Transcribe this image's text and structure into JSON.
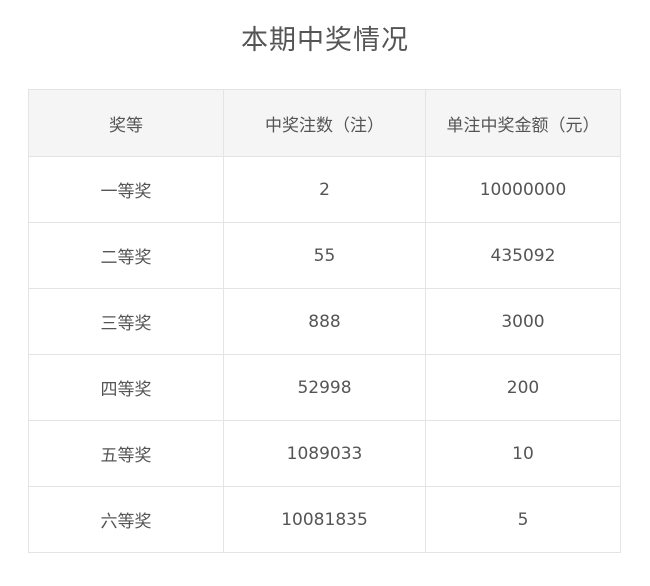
{
  "title": "本期中奖情况",
  "table": {
    "headers": [
      "奖等",
      "中奖注数（注）",
      "单注中奖金额（元）"
    ],
    "rows": [
      [
        "一等奖",
        "2",
        "10000000"
      ],
      [
        "二等奖",
        "55",
        "435092"
      ],
      [
        "三等奖",
        "888",
        "3000"
      ],
      [
        "四等奖",
        "52998",
        "200"
      ],
      [
        "五等奖",
        "1089033",
        "10"
      ],
      [
        "六等奖",
        "10081835",
        "5"
      ]
    ]
  }
}
